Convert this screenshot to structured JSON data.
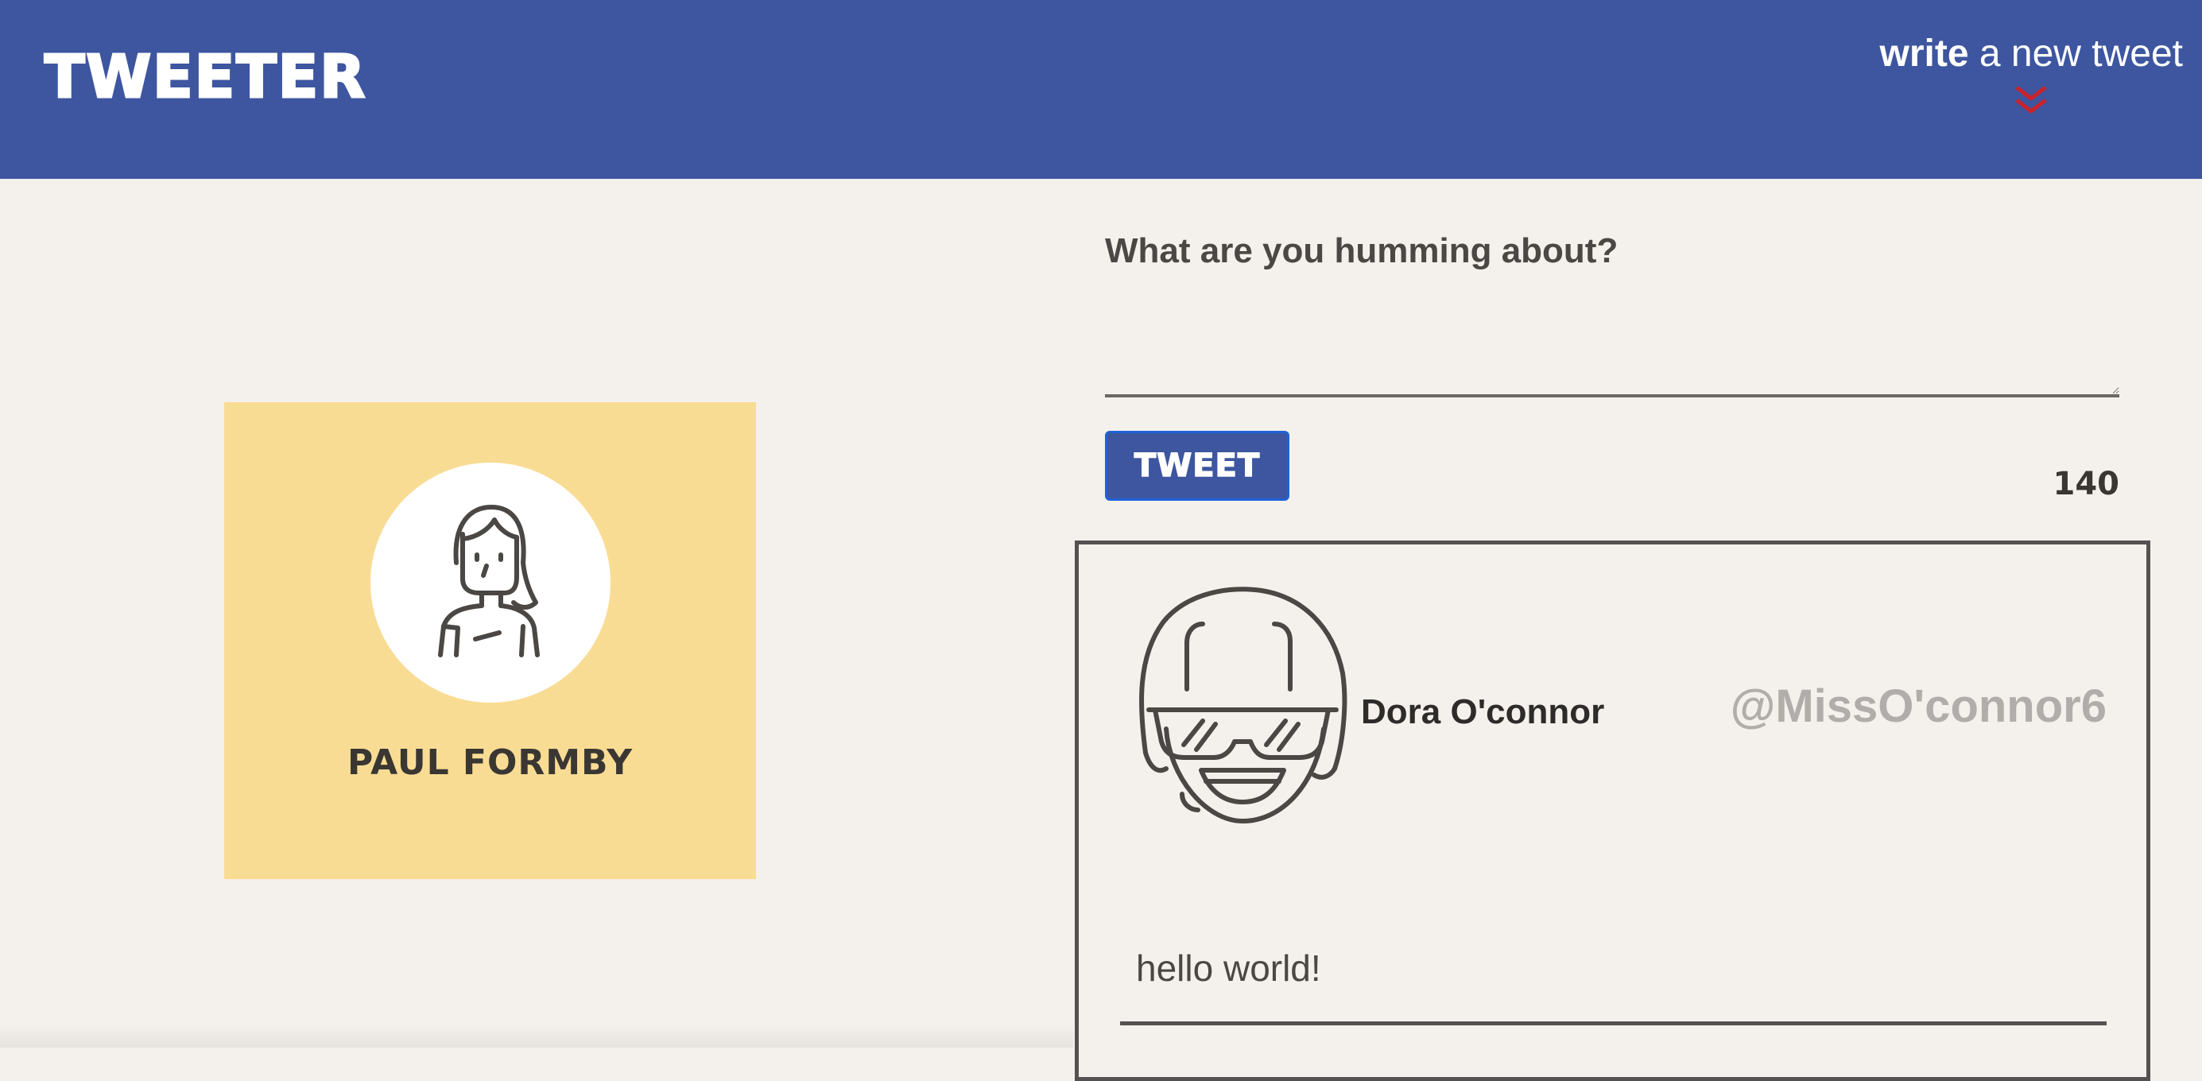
{
  "nav": {
    "brand": "TWEETER",
    "compose_toggle": {
      "bold": "write",
      "rest": " a new tweet",
      "icon": "double-chevron-down-icon",
      "icon_color": "#c8232c"
    },
    "background": "#3e56a0"
  },
  "profile": {
    "name": "PAUL FORMBY",
    "avatar_icon": "person-avatar-icon",
    "background": "#f9dc94"
  },
  "compose": {
    "prompt": "What are you humming about?",
    "textarea_value": "",
    "submit_label": "TWEET",
    "char_counter": "140"
  },
  "tweets": [
    {
      "avatar_icon": "goggles-face-avatar-icon",
      "name": "Dora O'connor",
      "handle": "@MissO'connor6",
      "content": "hello world!"
    }
  ],
  "colors": {
    "page_background": "#f4f1ec",
    "accent": "#3e56a0",
    "handle_gray": "#b0adaa",
    "chevron_red": "#c8232c"
  }
}
